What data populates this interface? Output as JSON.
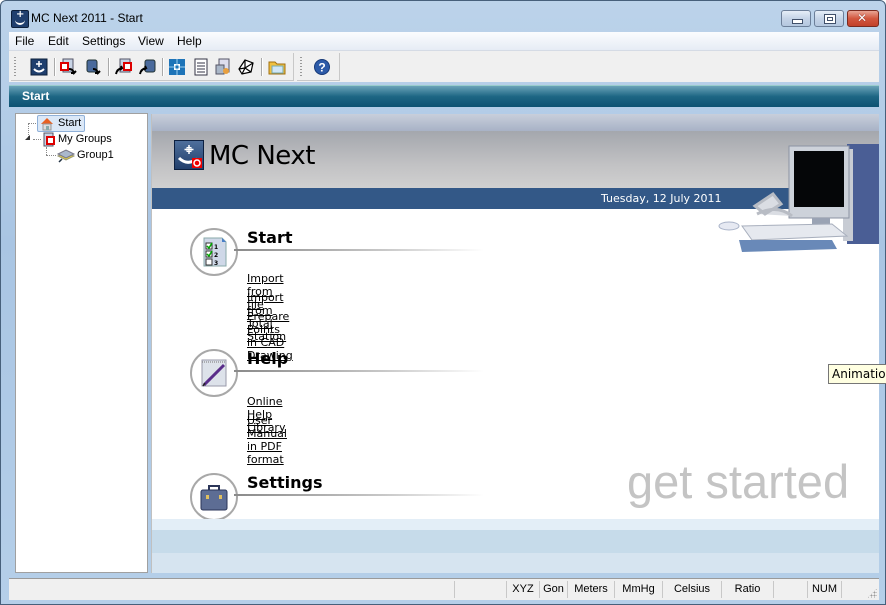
{
  "window": {
    "title": "MC Next 2011 - Start",
    "controls": {
      "minimize": "minimize",
      "maximize": "maximize",
      "close": "close"
    }
  },
  "menubar": {
    "items": [
      "File",
      "Edit",
      "Settings",
      "View",
      "Help"
    ]
  },
  "toolbar": {
    "buttons": [
      {
        "name": "start-page-icon"
      },
      {
        "name": "import-file-icon"
      },
      {
        "name": "import-total-station-icon"
      },
      {
        "name": "export-file-icon"
      },
      {
        "name": "export-total-station-icon"
      },
      {
        "name": "cad-points-icon"
      },
      {
        "name": "report-icon"
      },
      {
        "name": "preview-icon"
      },
      {
        "name": "wireframe-icon"
      },
      {
        "name": "open-folder-icon"
      },
      {
        "name": "help-icon"
      }
    ]
  },
  "doc_tab": {
    "label": "Start"
  },
  "tree": {
    "nodes": [
      {
        "label": "Start",
        "icon": "home-icon",
        "selected": true
      },
      {
        "label": "My Groups",
        "icon": "groups-icon",
        "expanded": true
      },
      {
        "label": "Group1",
        "icon": "layers-icon"
      }
    ]
  },
  "start_page": {
    "logo_text": "MC Next",
    "date": "Tuesday, 12 July 2011",
    "sections": [
      {
        "title": "Start",
        "icon": "checklist-icon",
        "links": [
          "Import from file",
          "Import from Total Station",
          "Prepare Points in CAD Drawing"
        ]
      },
      {
        "title": "Help",
        "icon": "notepad-pen-icon",
        "links": [
          "Online Help Library",
          "User Manual in PDF format"
        ]
      },
      {
        "title": "Settings",
        "icon": "briefcase-icon",
        "links": []
      }
    ],
    "watermark": "get started"
  },
  "tooltip": {
    "text": "Animation"
  },
  "statusbar": {
    "cells": [
      "",
      "XYZ",
      "Gon",
      "Meters",
      "MmHg",
      "Celsius",
      "Ratio",
      "",
      "NUM",
      ""
    ]
  }
}
